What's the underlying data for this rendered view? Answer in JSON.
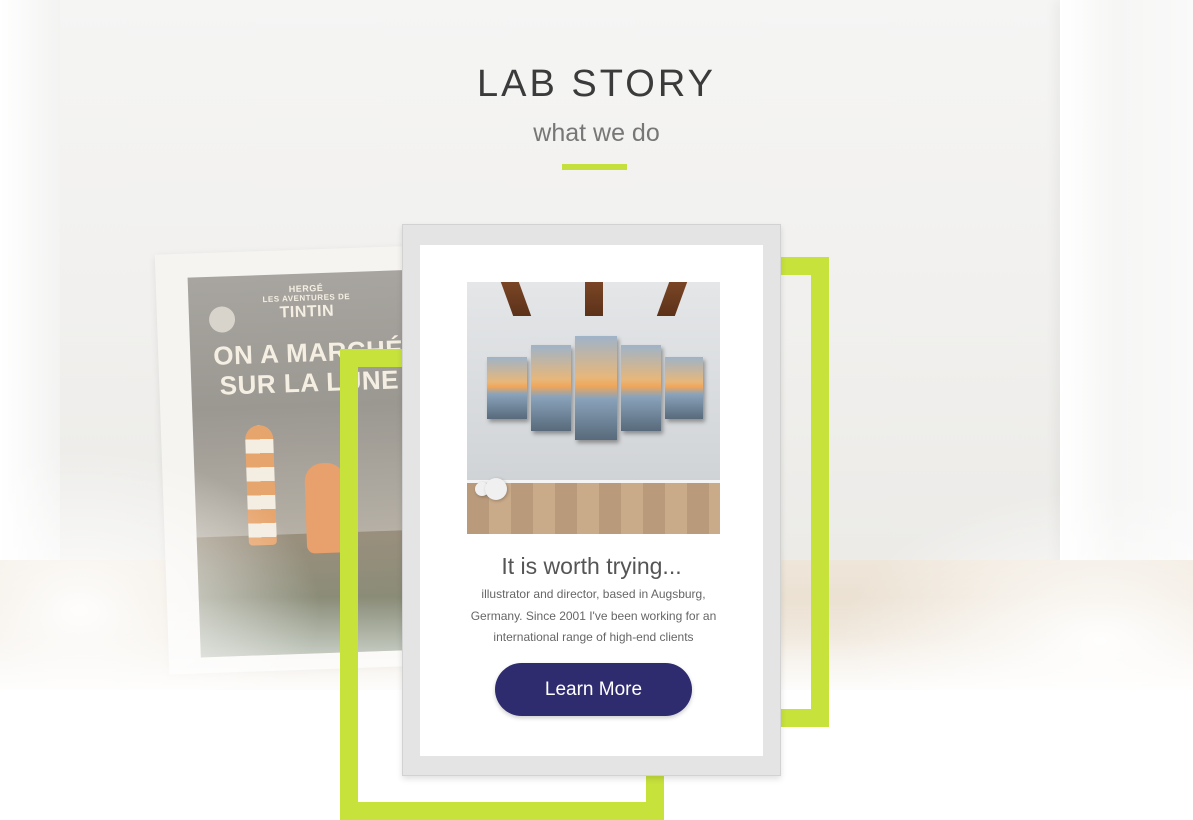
{
  "section": {
    "title": "LAB STORY",
    "subtitle": "what we do"
  },
  "card": {
    "heading": "It is worth trying...",
    "body": "illustrator and director, based in Augsburg, Germany. Since 2001 I've been working for an international range of high-end clients",
    "button_label": "Learn More"
  },
  "poster": {
    "author": "HERGÉ",
    "series": "LES AVENTURES DE",
    "name": "TINTIN",
    "line1": "ON A MARCHÉ",
    "line2": "SUR LA LUNE"
  },
  "colors": {
    "accent_green": "#c8e23c",
    "button_navy": "#2e2c6e",
    "title_text": "#3b3b3b"
  }
}
